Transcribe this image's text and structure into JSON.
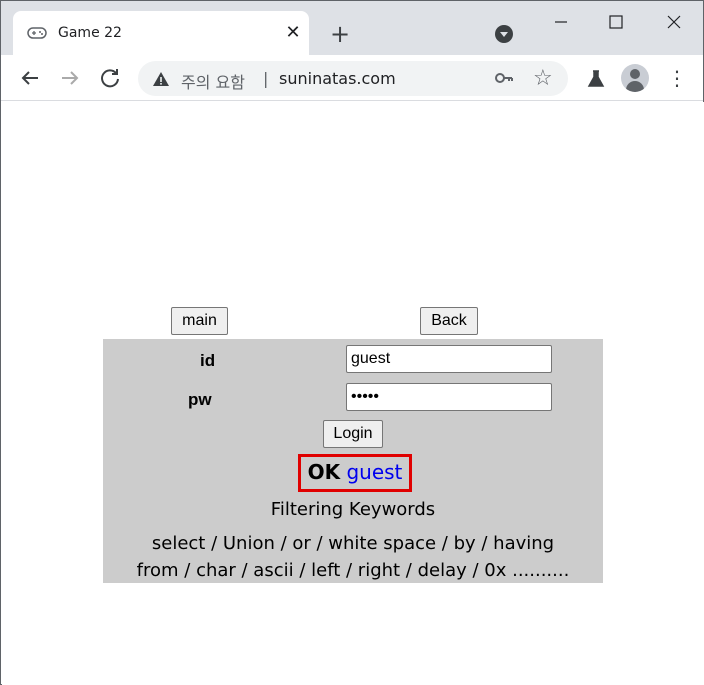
{
  "browser": {
    "tab_title": "Game 22",
    "tab_close": "✕",
    "new_tab": "+",
    "warning_label": "주의 요함",
    "url_separator": "|",
    "url": "suninatas.com",
    "icons": [
      "gamepad-icon",
      "close-icon",
      "plus-icon",
      "tab-search-icon",
      "minimize-icon",
      "maximize-icon",
      "close-window-icon",
      "back-icon",
      "forward-icon",
      "reload-icon",
      "warning-icon",
      "key-icon",
      "star-icon",
      "flask-icon",
      "avatar-icon",
      "menu-icon"
    ]
  },
  "page": {
    "main_button": "main",
    "back_button": "Back",
    "id_label": "id",
    "pw_label": "pw",
    "id_value": "guest",
    "pw_value": "•••••",
    "login_button": "Login",
    "ok_word": "OK",
    "ok_user": "guest",
    "filter_title": "Filtering Keywords",
    "filter_line1": "select / Union / or / white space / by / having",
    "filter_line2": "from / char / ascii / left / right / delay / 0x .........."
  },
  "colors": {
    "panel": "#cccccc",
    "highlight_border": "#e00000",
    "user_text": "#0000ee"
  }
}
